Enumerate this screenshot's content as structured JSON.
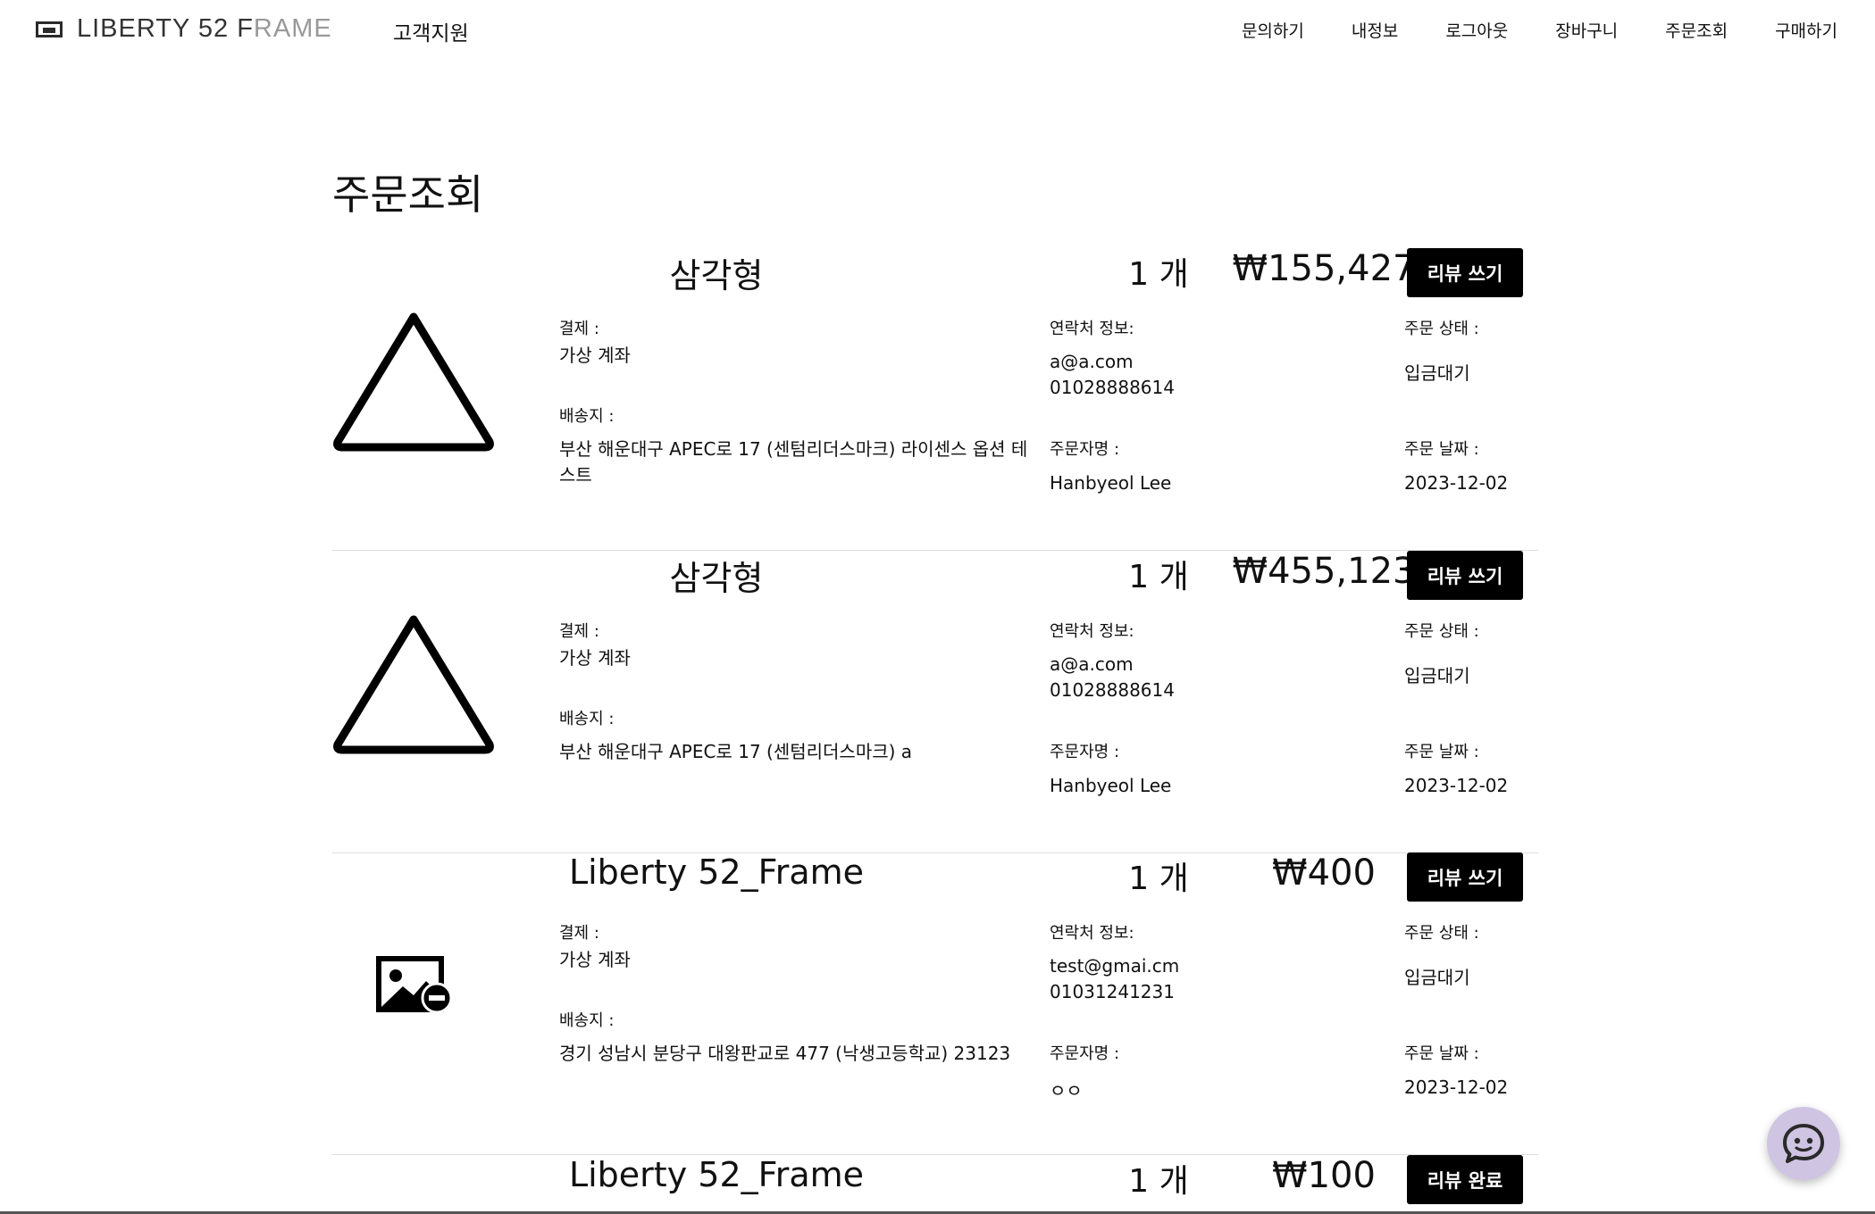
{
  "header": {
    "logo": {
      "dark": "LIBERTY 52 F",
      "brown": "",
      "grey": "RAME"
    },
    "support_label": "고객지원",
    "nav": [
      "문의하기",
      "내정보",
      "로그아웃",
      "장바구니",
      "주문조회",
      "구매하기"
    ]
  },
  "page": {
    "title": "주문조회"
  },
  "labels": {
    "payment": "결제 :",
    "shipping": "배송지 :",
    "contact": "연락처 정보:",
    "orderer": "주문자명 :",
    "status": "주문 상태 :",
    "date": "주문 날짜 :"
  },
  "orders": [
    {
      "thumbnail_icon": "triangle-icon",
      "product_name": "삼각형",
      "quantity": "1 개",
      "price": "₩155,427",
      "review_label": "리뷰 쓰기",
      "payment_method": "가상 계좌",
      "address": "부산 해운대구 APEC로 17 (센텀리더스마크) 라이센스 옵션 테스트",
      "email": "a@a.com",
      "phone": "01028888614",
      "orderer_name": "Hanbyeol Lee",
      "status": "입금대기",
      "date": "2023-12-02"
    },
    {
      "thumbnail_icon": "triangle-icon",
      "product_name": "삼각형",
      "quantity": "1 개",
      "price": "₩455,123",
      "review_label": "리뷰 쓰기",
      "payment_method": "가상 계좌",
      "address": "부산 해운대구 APEC로 17 (센텀리더스마크) a",
      "email": "a@a.com",
      "phone": "01028888614",
      "orderer_name": "Hanbyeol Lee",
      "status": "입금대기",
      "date": "2023-12-02"
    },
    {
      "thumbnail_icon": "image-not-found-icon",
      "product_name": "Liberty 52_Frame",
      "quantity": "1 개",
      "price": "₩400",
      "review_label": "리뷰 쓰기",
      "payment_method": "가상 계좌",
      "address": "경기 성남시 분당구 대왕판교로 477 (낙생고등학교) 23123",
      "email": "test@gmai.cm",
      "phone": "01031241231",
      "orderer_name": "ㅇㅇ",
      "status": "입금대기",
      "date": "2023-12-02"
    },
    {
      "product_name": "Liberty 52_Frame",
      "quantity": "1 개",
      "price": "₩100",
      "review_label": "리뷰 완료"
    }
  ],
  "chat": {
    "icon": "chat-bot-icon"
  },
  "colors": {
    "button_bg": "#000000",
    "chat_fab": "#cfc4e2",
    "divider": "#dddddd"
  }
}
